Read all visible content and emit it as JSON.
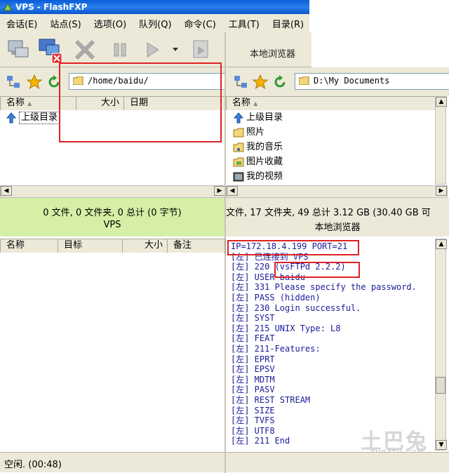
{
  "window": {
    "title": "VPS - FlashFXP"
  },
  "menu": [
    "会话(E)",
    "站点(S)",
    "选项(O)",
    "队列(Q)",
    "命令(C)",
    "工具(T)",
    "目录(R)"
  ],
  "right_toolbar_label": "本地浏览器",
  "left_pane": {
    "path": "/home/baidu/",
    "columns": [
      "名称",
      "大小",
      "日期"
    ],
    "rows": [
      "上级目录"
    ],
    "status_line1": "0 文件, 0 文件夹, 0 总计 (0 字节)",
    "status_line2": "VPS"
  },
  "right_pane": {
    "path": "D:\\My Documents",
    "columns": [
      "名称"
    ],
    "rows": [
      "上级目录",
      "照片",
      "我的音乐",
      "图片收藏",
      "我的视频"
    ],
    "status_line1": "文件, 17 文件夹, 49 总计 3.12 GB (30.40 GB 可",
    "status_line2": "本地浏览器"
  },
  "queue": {
    "columns": [
      "名称",
      "目标",
      "大小",
      "备注"
    ]
  },
  "log_lines": [
    "IP=172.18.4.199 PORT=21",
    "[左] 已连接到 VPS",
    "[左] 220 (vsFTPd 2.2.2)",
    "[左] USER baidu",
    "[左] 331 Please specify the password.",
    "[左] PASS (hidden)",
    "[左] 230 Login successful.",
    "[左] SYST",
    "[左] 215 UNIX Type: L8",
    "[左] FEAT",
    "[左] 211-Features:",
    "[左]  EPRT",
    "[左]  EPSV",
    "[左]  MDTM",
    "[左]  PASV",
    "[左]  REST STREAM",
    "[左]  SIZE",
    "[左]  TVFS",
    "[左]  UTF8",
    "[左] 211 End"
  ],
  "statusbar": {
    "text": "空闲. (00:48)"
  },
  "watermark": {
    "brand": "土巴兔",
    "url": "TUBATU.COM"
  },
  "colors": {
    "highlight": "#d22222",
    "status_green": "#d5f0a6",
    "log_text": "#1a1a99"
  }
}
